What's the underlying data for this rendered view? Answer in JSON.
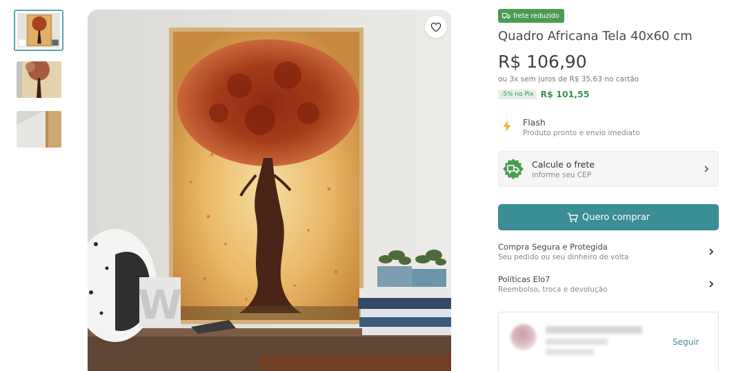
{
  "gallery": {
    "thumbnails": [
      "thumbnail-1",
      "thumbnail-2",
      "thumbnail-3"
    ],
    "selected_index": 0
  },
  "product": {
    "badge": "frete reduzido",
    "title": "Quadro Africana Tela 40x60 cm",
    "price": "R$ 106,90",
    "installments": "ou 3x sem juros de R$ 35,63 no cartão",
    "pix_discount": "-5% no Pix",
    "pix_price": "R$ 101,55"
  },
  "flash": {
    "title": "Flash",
    "subtitle": "Produto pronto e envio imediato"
  },
  "shipping": {
    "title": "Calcule o frete",
    "subtitle": "informe seu CEP"
  },
  "buy_button": {
    "label": "Quero comprar"
  },
  "info_rows": [
    {
      "title": "Compra Segura e Protegida",
      "subtitle": "Seu pedido ou seu dinheiro de volta"
    },
    {
      "title": "Políticas Elo7",
      "subtitle": "Reembolso, troca e devolução"
    }
  ],
  "seller": {
    "follow_label": "Seguir"
  },
  "colors": {
    "accent": "#3a8e94",
    "badge_green": "#4b9b52",
    "pix_green": "#3f8f47"
  },
  "icons": [
    "heart-icon",
    "truck-icon",
    "lightning-icon",
    "shipping-truck-icon",
    "cart-icon",
    "chevron-right-icon"
  ]
}
